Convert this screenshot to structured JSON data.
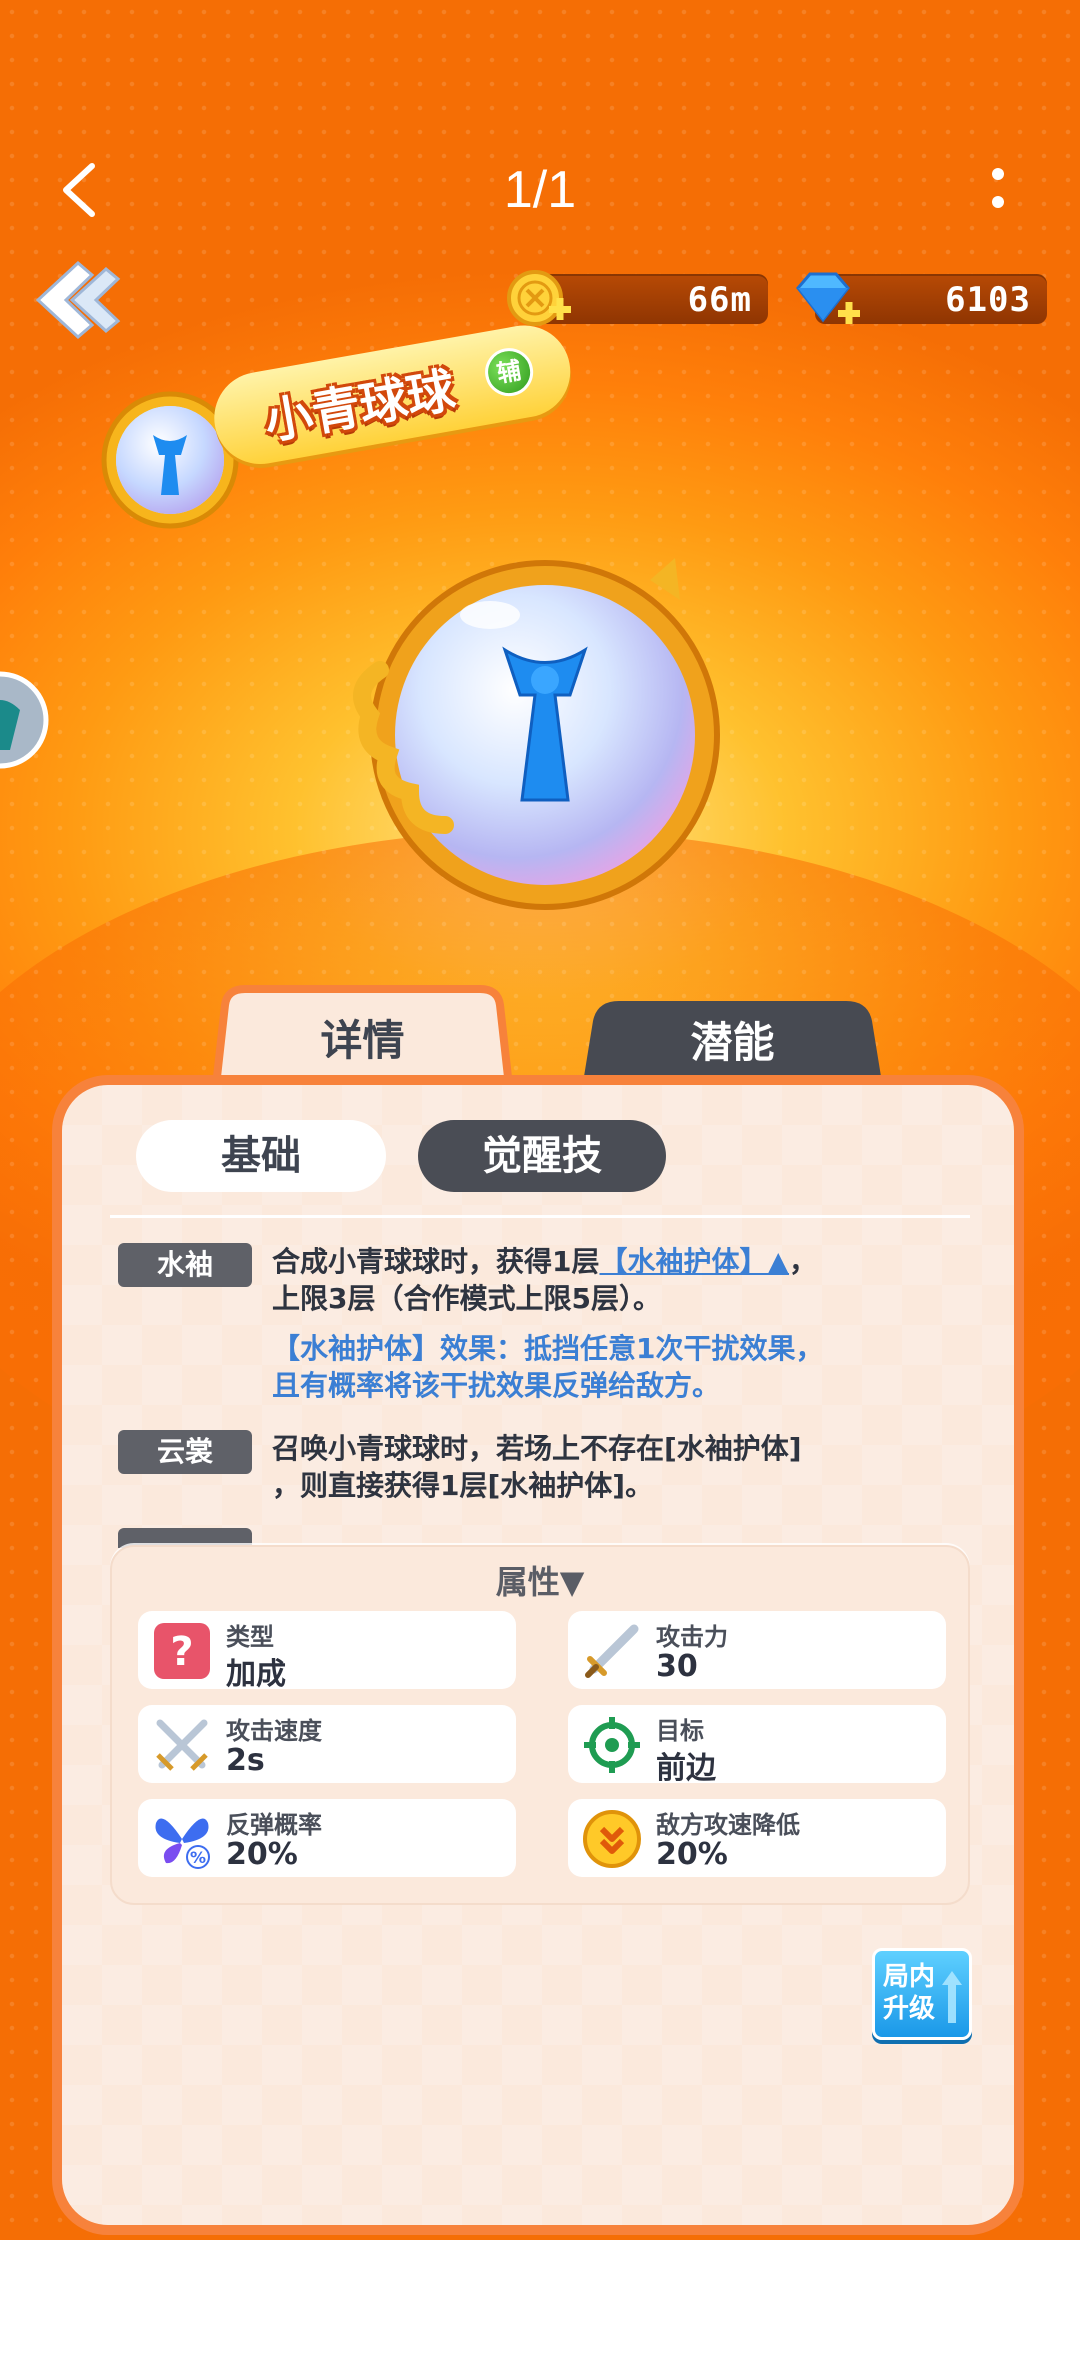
{
  "header": {
    "page_counter": "1/1"
  },
  "resources": {
    "coins": "66m",
    "gems": "6103"
  },
  "hero": {
    "name": "小青球球",
    "role_badge": "辅"
  },
  "tabs": [
    {
      "label": "详情",
      "active": true
    },
    {
      "label": "潜能",
      "active": false
    }
  ],
  "subtabs": [
    {
      "label": "基础",
      "active": true
    },
    {
      "label": "觉醒技",
      "active": false
    }
  ],
  "skills": [
    {
      "tag": "水袖",
      "line1_prefix": "合成小青球球时，获得1层",
      "line1_link": "【水袖护体】▲",
      "line1_suffix": "，",
      "line2": "上限3层（合作模式上限5层）。",
      "note1": "【水袖护体】效果：抵挡任意1次干扰效果，",
      "note2": "且有概率将该干扰效果反弹给敌方。"
    },
    {
      "tag": "云裳",
      "line1": "召唤小青球球时，若场上不存在[水袖护体]",
      "line2": "，则直接获得1层[水袖护体]。"
    }
  ],
  "attributes": {
    "header": "属性▼",
    "items": [
      {
        "icon": "question-icon",
        "label": "类型",
        "value": "加成"
      },
      {
        "icon": "sword-icon",
        "label": "攻击力",
        "value": "30"
      },
      {
        "icon": "crossed-swords-icon",
        "label": "攻击速度",
        "value": "2s"
      },
      {
        "icon": "target-icon",
        "label": "目标",
        "value": "前边"
      },
      {
        "icon": "butterfly-percent-icon",
        "label": "反弹概率",
        "value": "20%"
      },
      {
        "icon": "speed-down-coin-icon",
        "label": "敌方攻速降低",
        "value": "20%"
      }
    ]
  },
  "upgrade_button": {
    "line1": "局内",
    "line2": "升级"
  },
  "colors": {
    "panel_border": "#f7823b",
    "panel_bg": "#fbe9dc",
    "tag_bg": "#5f6168",
    "link_blue": "#3b7fd4",
    "upgrade_blue": "#1a98e8"
  }
}
